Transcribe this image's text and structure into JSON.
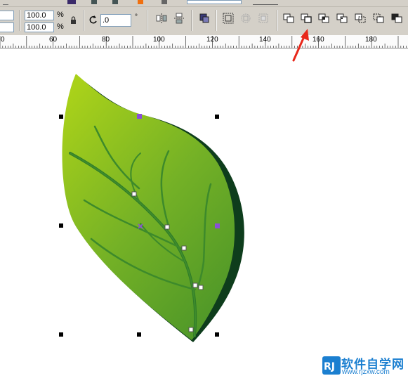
{
  "toolbar": {
    "width_field": "",
    "height_field": "",
    "scale_x": "100.0",
    "scale_y": "100.0",
    "percent_x": "%",
    "percent_y": "%",
    "rotation": ".0",
    "degree": "°",
    "icons": [
      "lock-icon",
      "rotate-icon",
      "mirror-horizontal-icon",
      "mirror-vertical-icon",
      "order-icon",
      "group-icon",
      "ungroup-icon",
      "ungroup-all-icon",
      "weld-icon",
      "trim-icon",
      "intersect-icon",
      "simplify-icon",
      "front-minus-back-icon",
      "back-minus-front-icon",
      "boundary-icon"
    ]
  },
  "ruler": {
    "labels": [
      "0",
      "60",
      "80",
      "100",
      "120",
      "140",
      "160",
      "180"
    ]
  },
  "watermark": {
    "logo": "RJ",
    "text": "软件自学网",
    "url": "www.rjzxw.com"
  },
  "colors": {
    "ui_face": "#d4d0c8",
    "arrow": "#e8271a",
    "leaf_light": "#a8cf1a",
    "leaf_dark": "#4c8f24",
    "shadow": "#0e3d1c",
    "node": "#8a4fd6"
  }
}
